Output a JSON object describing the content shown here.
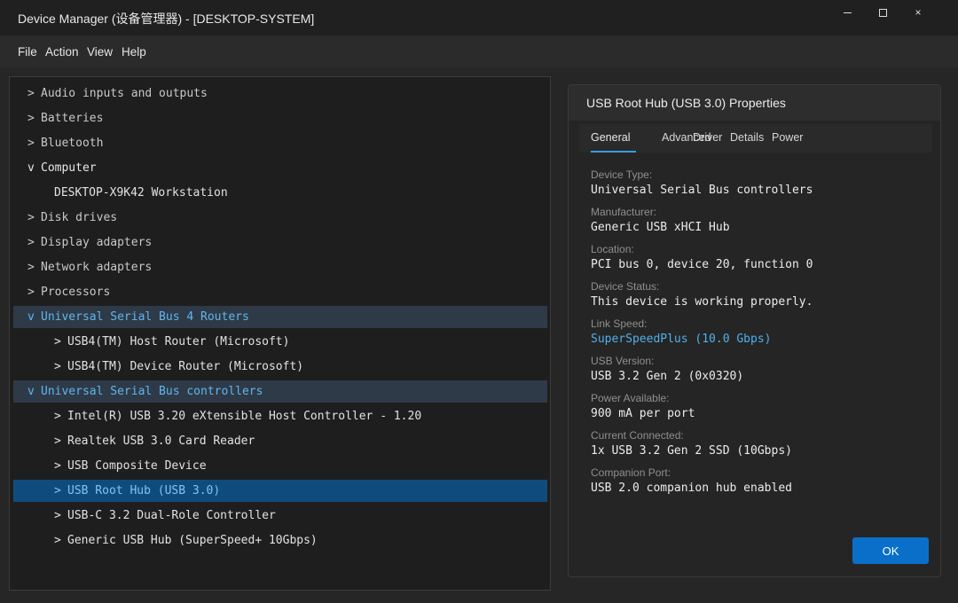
{
  "window": {
    "title": "Device Manager (设备管理器) - [DESKTOP-SYSTEM]",
    "minimize": "minimize-icon",
    "maximize": "maximize-icon",
    "close": "×"
  },
  "menu": [
    "File",
    "Action",
    "View",
    "Help"
  ],
  "tree": [
    {
      "arrow": ">",
      "label": "Audio inputs and outputs"
    },
    {
      "arrow": ">",
      "label": "Batteries"
    },
    {
      "arrow": ">",
      "label": "Bluetooth"
    },
    {
      "arrow": "v",
      "label": "Computer"
    },
    {
      "arrow": "",
      "label": "DESKTOP-X9K42 Workstation"
    },
    {
      "arrow": ">",
      "label": "Disk drives"
    },
    {
      "arrow": ">",
      "label": "Display adapters"
    },
    {
      "arrow": ">",
      "label": "Network adapters"
    },
    {
      "arrow": ">",
      "label": "Processors"
    },
    {
      "arrow": "v",
      "label": "Universal Serial Bus 4 Routers"
    },
    {
      "arrow": ">",
      "label": "USB4(TM) Host Router (Microsoft)"
    },
    {
      "arrow": ">",
      "label": "USB4(TM) Device Router (Microsoft)"
    },
    {
      "arrow": "v",
      "label": "Universal Serial Bus controllers"
    },
    {
      "arrow": ">",
      "label": "Intel(R) USB 3.20 eXtensible Host Controller - 1.20"
    },
    {
      "arrow": ">",
      "label": "Realtek USB 3.0 Card Reader"
    },
    {
      "arrow": ">",
      "label": "USB Composite Device"
    },
    {
      "arrow": ">",
      "label": "USB Root Hub (USB 3.0)"
    },
    {
      "arrow": ">",
      "label": "USB-C 3.2 Dual-Role Controller"
    },
    {
      "arrow": ">",
      "label": "Generic USB Hub (SuperSpeed+ 10Gbps)"
    }
  ],
  "dialog": {
    "title": "USB Root Hub (USB 3.0) Properties",
    "tabs": [
      "General",
      "Advanced",
      "Driver",
      "Details",
      "Power"
    ],
    "properties": [
      {
        "label": "Device Type:",
        "value": "Universal Serial Bus controllers"
      },
      {
        "label": "Manufacturer:",
        "value": "Generic USB xHCI Hub"
      },
      {
        "label": "Location:",
        "value": "PCI bus 0, device 20, function 0"
      },
      {
        "label": "Device Status:",
        "value": "This device is working properly."
      },
      {
        "label": "Link Speed:",
        "value": "SuperSpeedPlus (10.0 Gbps)"
      },
      {
        "label": "USB Version:",
        "value": "USB 3.2 Gen 2 (0x0320)"
      },
      {
        "label": "Power Available:",
        "value": "900 mA per port"
      },
      {
        "label": "Current Connected:",
        "value": "1x USB 3.2 Gen 2 SSD (10Gbps)"
      },
      {
        "label": "Companion Port:",
        "value": "USB 2.0 companion hub enabled"
      }
    ],
    "ok_label": "OK"
  },
  "colors": {
    "accent": "#0a6fc9",
    "selection": "#0f4c7d",
    "category_highlight": "#2f3a48",
    "link_text": "#4fb0ea"
  }
}
